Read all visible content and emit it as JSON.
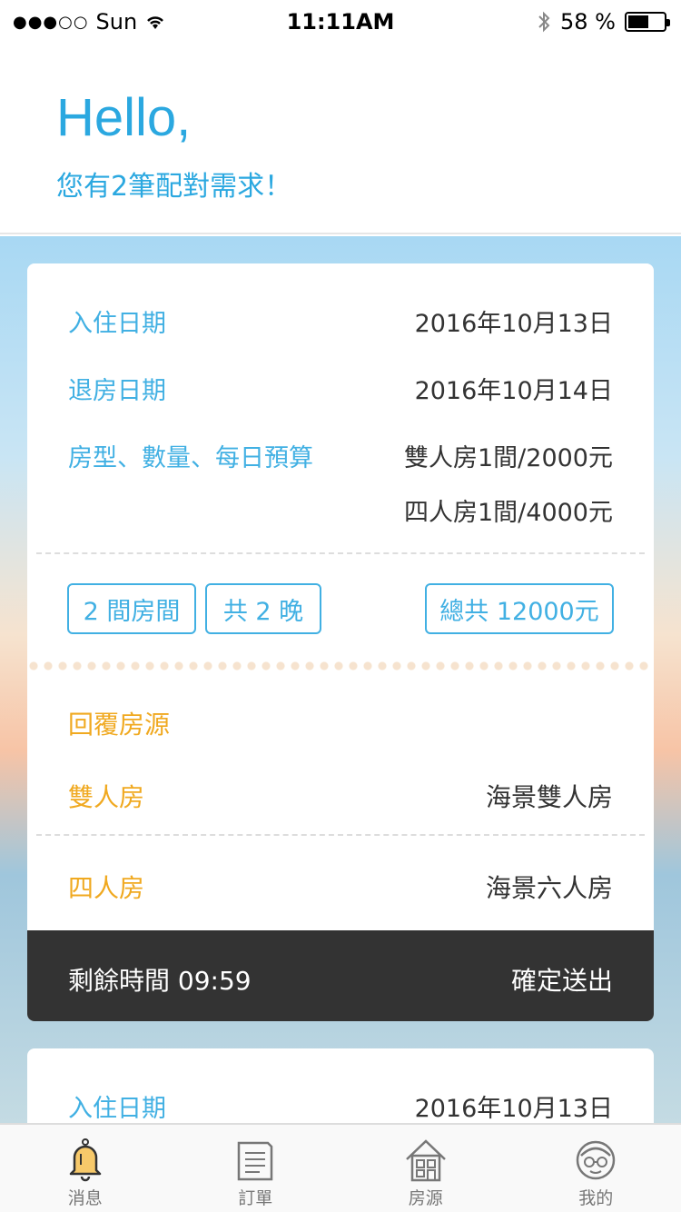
{
  "status_bar": {
    "signal": "●●●○○",
    "carrier": "Sun",
    "time": "11:11AM",
    "battery": "58 %",
    "battery_level": 0.58
  },
  "header": {
    "hello": "Hello,",
    "subtitle": "您有2筆配對需求！"
  },
  "card1": {
    "checkin_label": "入住日期",
    "checkin_value": "2016年10月13日",
    "checkout_label": "退房日期",
    "checkout_value": "2016年10月14日",
    "room_label": "房型、數量、每日預算",
    "room_values": [
      "雙人房1間/2000元",
      "四人房1間/4000元"
    ],
    "tag_rooms": "2 間房間",
    "tag_nights": "共 2 晚",
    "tag_total": "總共 12000元",
    "reply_title": "回覆房源",
    "replies": [
      {
        "type": "雙人房",
        "room": "海景雙人房"
      },
      {
        "type": "四人房",
        "room": "海景六人房"
      }
    ],
    "timer": "剩餘時間 09:59",
    "submit": "確定送出"
  },
  "card2": {
    "checkin_label": "入住日期",
    "checkin_value": "2016年10月13日"
  },
  "tabbar": [
    {
      "label": "消息",
      "icon": "bell-icon",
      "active": true
    },
    {
      "label": "訂單",
      "icon": "document-icon"
    },
    {
      "label": "房源",
      "icon": "house-icon"
    },
    {
      "label": "我的",
      "icon": "profile-icon"
    }
  ],
  "colors": {
    "accent_blue": "#2ba8e0",
    "accent_orange": "#f0a920",
    "dark_bar": "#333333"
  }
}
